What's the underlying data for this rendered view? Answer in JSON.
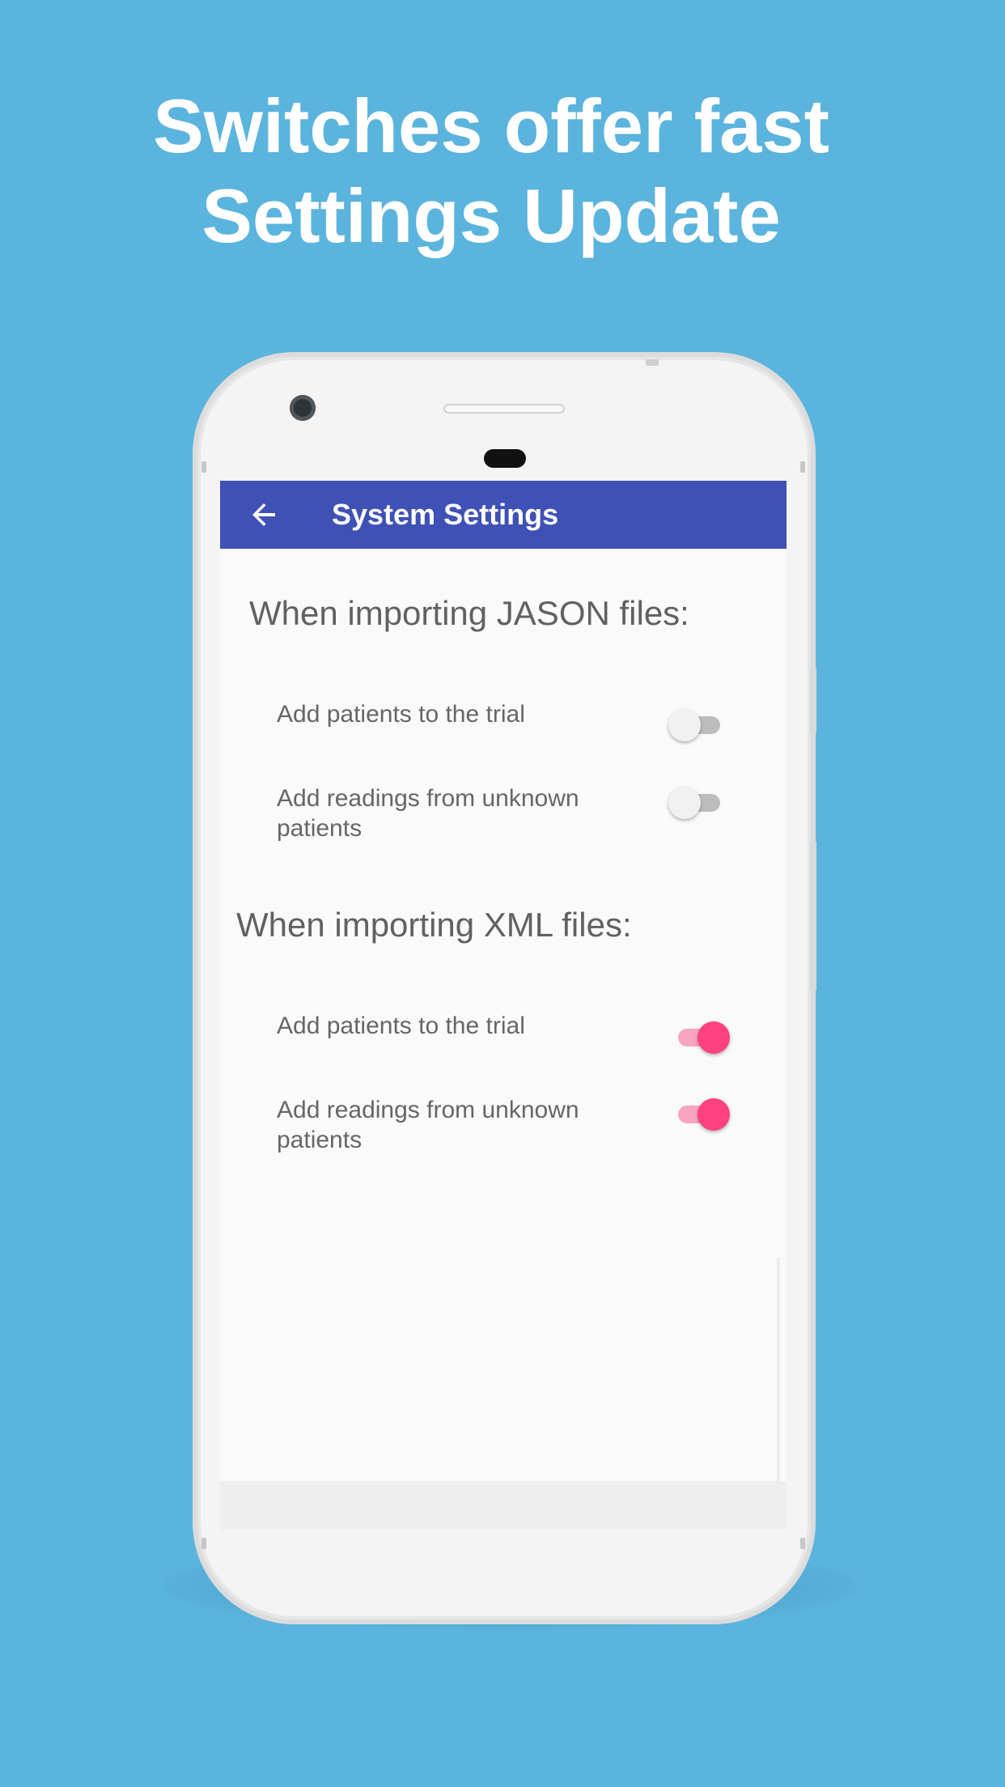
{
  "headline": {
    "line1": "Switches offer fast",
    "line2": "Settings Update"
  },
  "appbar": {
    "title": "System Settings",
    "back_icon": "arrow-left-icon",
    "color": "#3f51b5"
  },
  "sections": [
    {
      "title": "When importing JASON files:",
      "rows": [
        {
          "label": "Add patients to the trial",
          "on": false
        },
        {
          "label": "Add readings from unknown patients",
          "on": false
        }
      ]
    },
    {
      "title": "When importing XML files:",
      "rows": [
        {
          "label": "Add patients to the trial",
          "on": true
        },
        {
          "label": "Add readings from unknown patients",
          "on": true
        }
      ]
    }
  ],
  "colors": {
    "background": "#5bb4dd",
    "switch_on": "#ff4081",
    "switch_off": "#f1f1f1"
  }
}
